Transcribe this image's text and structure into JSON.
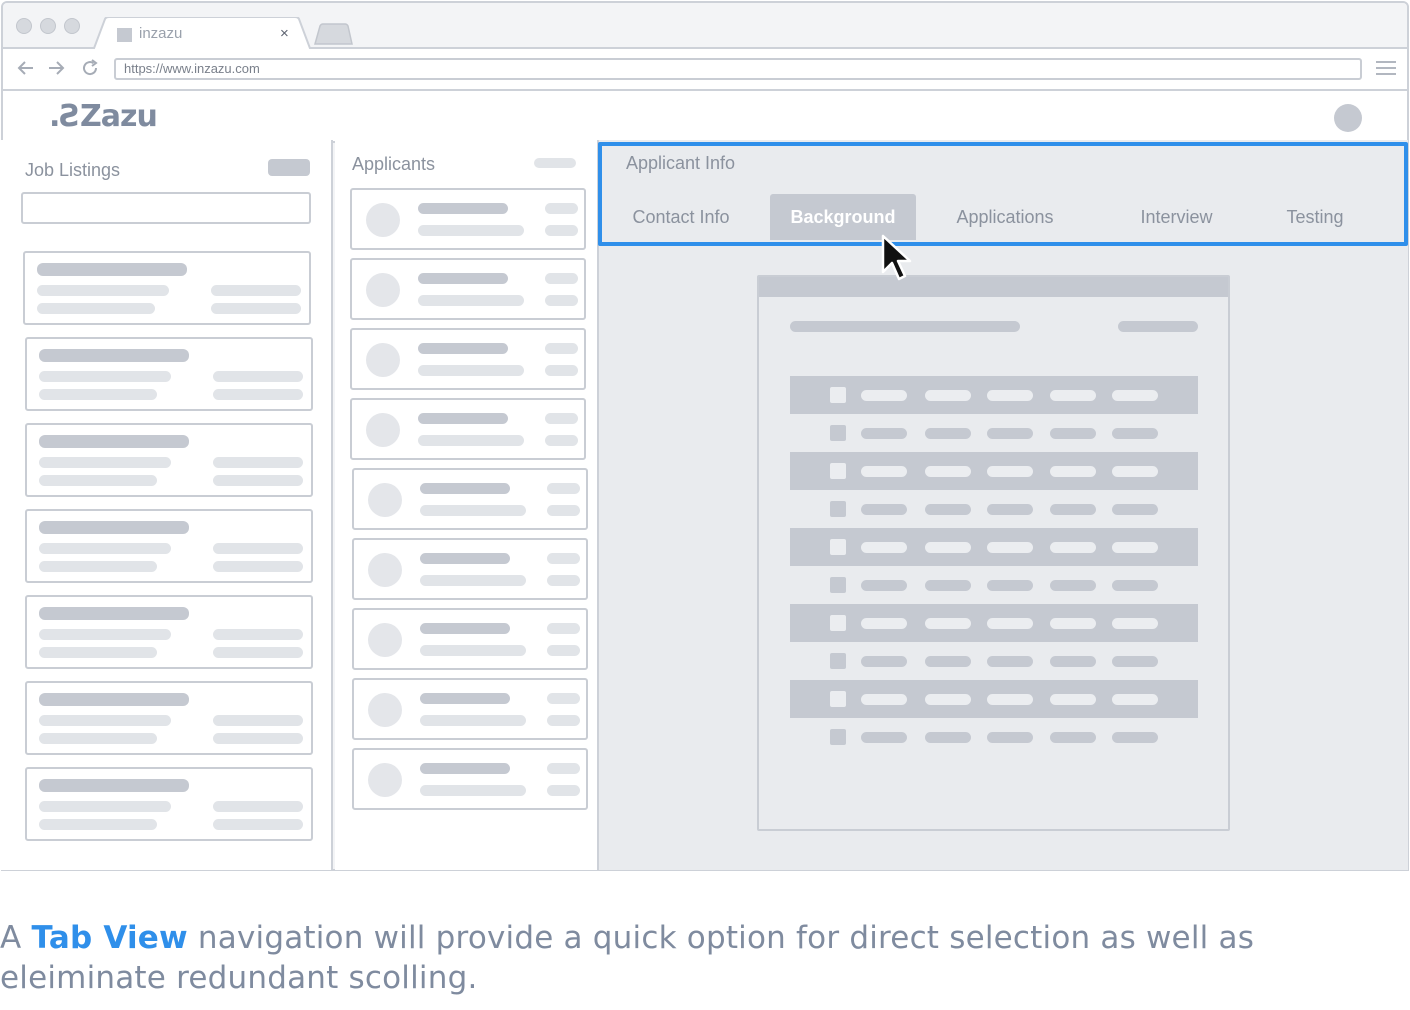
{
  "browser": {
    "tab_title": "inzazu",
    "tab_close": "×",
    "url": "https://www.inzazu.com",
    "icons": [
      "back-arrow-icon",
      "forward-arrow-icon",
      "reload-icon",
      "hamburger-menu-icon"
    ]
  },
  "app": {
    "logo": ".ƧZazu"
  },
  "job_listings": {
    "title": "Job Listings",
    "card_count": 7
  },
  "applicants": {
    "title": "Applicants",
    "card_count": 9
  },
  "applicant_info": {
    "title": "Applicant Info",
    "tabs": [
      "Contact Info",
      "Background",
      "Applications",
      "Interview",
      "Testing"
    ],
    "active_tab": "Background"
  },
  "caption": {
    "prefix": "A ",
    "highlight": "Tab View",
    "rest": " navigation will provide a quick option for direct selection as well as eleiminate redundant scolling."
  },
  "colors": {
    "accent": "#2f8fea",
    "placeholder": "#c5c9d1",
    "placeholder_light": "#e1e4e8",
    "text_muted": "#8b929e"
  }
}
